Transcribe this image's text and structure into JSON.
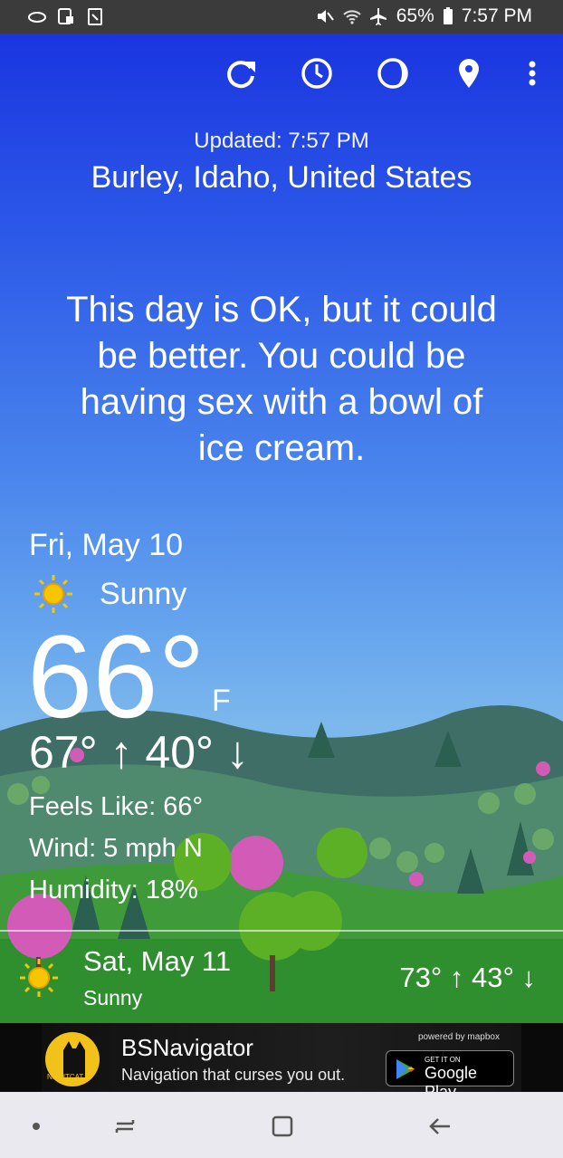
{
  "status_bar": {
    "battery": "65%",
    "time": "7:57 PM"
  },
  "toolbar": {
    "refresh": "refresh-icon",
    "hourly": "hourly-clock-icon",
    "moon": "moon-phase-icon",
    "location": "location-pin-icon",
    "more": "more-vert-icon"
  },
  "header": {
    "updated": "Updated: 7:57 PM",
    "location": "Burley, Idaho, United States"
  },
  "quote": {
    "line1": "This day is OK, but it could",
    "line2": "be better. You could be",
    "line3": "having sex with a bowl of",
    "line4": "ice cream."
  },
  "today": {
    "date": "Fri, May 10",
    "condition": "Sunny",
    "temp": "66°",
    "unit": "F",
    "hilo": "67° ↑  40° ↓",
    "feels_like": "Feels Like: 66°",
    "wind": "Wind: 5 mph N",
    "humidity": "Humidity: 18%"
  },
  "forecast": [
    {
      "date": "Sat, May 11",
      "condition": "Sunny",
      "hilo": "73° ↑  43° ↓"
    }
  ],
  "ad": {
    "brand_small": "NIGHTCAT",
    "title": "BSNavigator",
    "subtitle": "Navigation that curses you out.",
    "powered_by": "powered by  mapbox",
    "store_small": "GET IT ON",
    "store_big": "Google Play"
  },
  "colors": {
    "sky_top": "#1a35e0",
    "sky_bottom": "#7cb8ec",
    "sun": "#f7c600"
  }
}
